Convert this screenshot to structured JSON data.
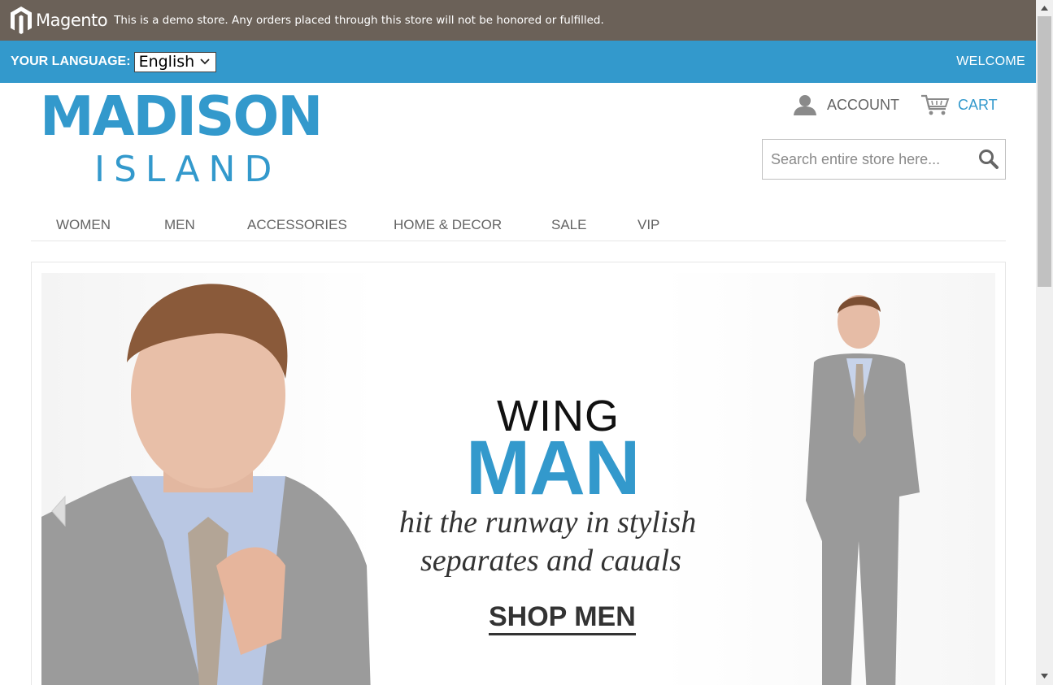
{
  "demo_notice": {
    "brand": "Magento",
    "text": "This is a demo store. Any orders placed through this store will not be honored or fulfilled."
  },
  "top_bar": {
    "language_label": "YOUR LANGUAGE:",
    "language_value": "English",
    "welcome": "WELCOME"
  },
  "logo": {
    "line1": "MADISON",
    "line2": "ISLAND"
  },
  "header_links": {
    "account": "ACCOUNT",
    "cart": "CART"
  },
  "search": {
    "placeholder": "Search entire store here..."
  },
  "nav": {
    "items": [
      "WOMEN",
      "MEN",
      "ACCESSORIES",
      "HOME & DECOR",
      "SALE",
      "VIP"
    ]
  },
  "banner": {
    "line1": "WING",
    "line2": "MAN",
    "tagline1": "hit the runway in stylish",
    "tagline2": "separates and cauals",
    "cta": "SHOP MEN"
  },
  "colors": {
    "demo_bar": "#6b6158",
    "accent": "#3399cc",
    "text": "#636363"
  },
  "icons": [
    "magento-logo-icon",
    "chevron-down-icon",
    "account-icon",
    "cart-icon",
    "search-icon",
    "prev-arrow-icon"
  ]
}
